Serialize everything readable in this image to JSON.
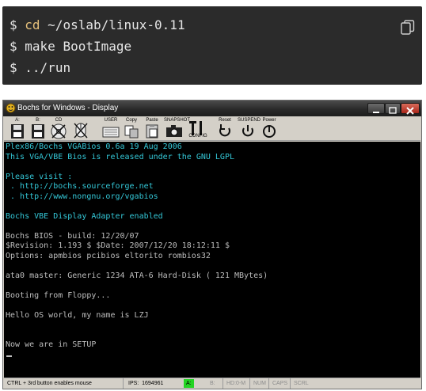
{
  "code": {
    "prompt": "$",
    "lines": [
      {
        "cmd": "cd",
        "args": " ~/oslab/linux-0.11"
      },
      {
        "text": "make BootImage"
      },
      {
        "text": "../run"
      }
    ],
    "copy_icon": "copy-icon"
  },
  "window": {
    "title": "Bochs for Windows - Display",
    "toolbar": {
      "buttons": [
        {
          "label": "A:",
          "icon": "floppy-a-icon"
        },
        {
          "label": "B:",
          "icon": "floppy-b-icon"
        },
        {
          "label": "CD",
          "icon": "cdrom-icon"
        },
        {
          "label": "",
          "icon": "mouse-icon"
        },
        {
          "label": "USER",
          "icon": "user-icon"
        },
        {
          "label": "Copy",
          "icon": "copy-icon"
        },
        {
          "label": "Paste",
          "icon": "paste-icon"
        },
        {
          "label": "SNAPSHOT",
          "icon": "snapshot-icon"
        },
        {
          "label": "CONFIG",
          "icon": "config-icon"
        },
        {
          "label": "Reset",
          "icon": "reset-icon"
        },
        {
          "label": "SUSPEND",
          "icon": "suspend-icon"
        },
        {
          "label": "Power",
          "icon": "power-icon"
        }
      ]
    },
    "screen_lines": [
      {
        "text": "Plex86/Bochs VGABios 0.6a 19 Aug 2006",
        "color": "cyan"
      },
      {
        "text": "This VGA/VBE Bios is released under the GNU LGPL",
        "color": "cyan"
      },
      {
        "text": "",
        "color": "cyan"
      },
      {
        "text": "Please visit :",
        "color": "cyan"
      },
      {
        "text": " . http://bochs.sourceforge.net",
        "color": "cyan"
      },
      {
        "text": " . http://www.nongnu.org/vgabios",
        "color": "cyan"
      },
      {
        "text": "",
        "color": "cyan"
      },
      {
        "text": "Bochs VBE Display Adapter enabled",
        "color": "cyan"
      },
      {
        "text": "",
        "color": "gray"
      },
      {
        "text": "Bochs BIOS - build: 12/20/07",
        "color": "gray"
      },
      {
        "text": "$Revision: 1.193 $ $Date: 2007/12/20 18:12:11 $",
        "color": "gray"
      },
      {
        "text": "Options: apmbios pcibios eltorito rombios32",
        "color": "gray"
      },
      {
        "text": "",
        "color": "gray"
      },
      {
        "text": "ata0 master: Generic 1234 ATA-6 Hard-Disk ( 121 MBytes)",
        "color": "gray"
      },
      {
        "text": "",
        "color": "gray"
      },
      {
        "text": "Booting from Floppy...",
        "color": "gray"
      },
      {
        "text": "",
        "color": "gray"
      },
      {
        "text": "Hello OS world, my name is LZJ",
        "color": "gray"
      },
      {
        "text": "",
        "color": "gray"
      },
      {
        "text": "",
        "color": "gray"
      },
      {
        "text": "Now we are in SETUP",
        "color": "gray"
      }
    ],
    "status": {
      "hint": "CTRL + 3rd button enables mouse",
      "ips": "IPS:  1694961",
      "drive_a": "A:",
      "drive_b": "B:",
      "hd": "HD:0-M",
      "num": "NUM",
      "caps": "CAPS",
      "scrl": "SCRL"
    }
  }
}
